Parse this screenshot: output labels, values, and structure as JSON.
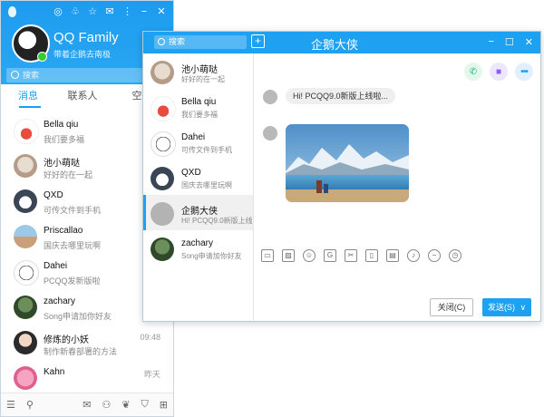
{
  "main": {
    "name": "QQ Family",
    "signature": "带着企鹅去南极",
    "search_placeholder": "搜索",
    "tabs": [
      {
        "label": "消息"
      },
      {
        "label": "联系人"
      },
      {
        "label": "空"
      }
    ],
    "contacts": [
      {
        "name": "Bella qiu",
        "message": "我们要多福",
        "time": ""
      },
      {
        "name": "池小萌哒",
        "message": "好好的在一起",
        "time": ""
      },
      {
        "name": "QXD",
        "message": "可传文件到手机",
        "time": ""
      },
      {
        "name": "Priscallao",
        "message": "国庆去哪里玩啊",
        "time": ""
      },
      {
        "name": "Dahei",
        "message": "PCQQ发新版啦",
        "time": ""
      },
      {
        "name": "zachary",
        "message": "Song申请加你好友",
        "time": ""
      },
      {
        "name": "修炼的小妖",
        "message": "制作新春部署的方法",
        "time": "09:48"
      },
      {
        "name": "Kahn",
        "message": "",
        "time": "昨天"
      }
    ]
  },
  "chat": {
    "title": "企鹅大侠",
    "search_placeholder": "搜索",
    "add_symbol": "+",
    "list": [
      {
        "name": "池小萌哒",
        "message": "好好的在一起"
      },
      {
        "name": "Bella qiu",
        "message": "我们要多福"
      },
      {
        "name": "Dahei",
        "message": "可传文件到手机"
      },
      {
        "name": "QXD",
        "message": "国庆去哪里玩啊"
      },
      {
        "name": "企鹅大侠",
        "message": "Hi! PCQQ9.0新版上线"
      },
      {
        "name": "zachary",
        "message": "Song申请加你好友"
      }
    ],
    "message_text": "Hi! PCQQ9.0新版上线啦...",
    "close_label": "关闭(C)",
    "send_label": "发送(S)",
    "send_arrow": "∨"
  },
  "colors": {
    "accent": "#1ea1f1",
    "online": "#33cc33"
  }
}
